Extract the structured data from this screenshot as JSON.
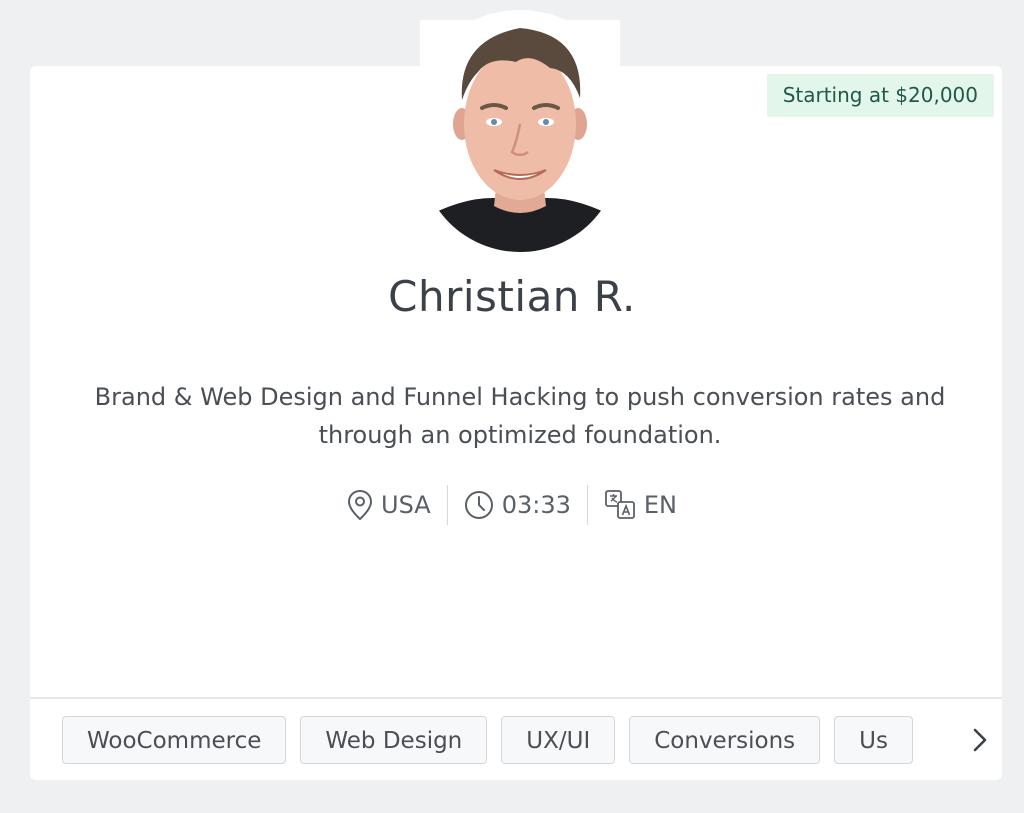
{
  "profile": {
    "name": "Christian R.",
    "price_badge": "Starting at $20,000",
    "bio": "Brand & Web Design and Funnel Hacking to push conversion rates and through an optimized foundation.",
    "location": "USA",
    "local_time": "03:33",
    "language": "EN"
  },
  "icons": {
    "location": "map-pin-icon",
    "time": "clock-icon",
    "language": "translate-icon",
    "next": "chevron-right-icon"
  },
  "tags": [
    "WooCommerce",
    "Web Design",
    "UX/UI",
    "Conversions",
    "Us"
  ],
  "colors": {
    "badge_bg": "#e3f6ec",
    "badge_text": "#1f5b3c",
    "name_text": "#3b4148",
    "page_bg": "#eef0f2"
  }
}
